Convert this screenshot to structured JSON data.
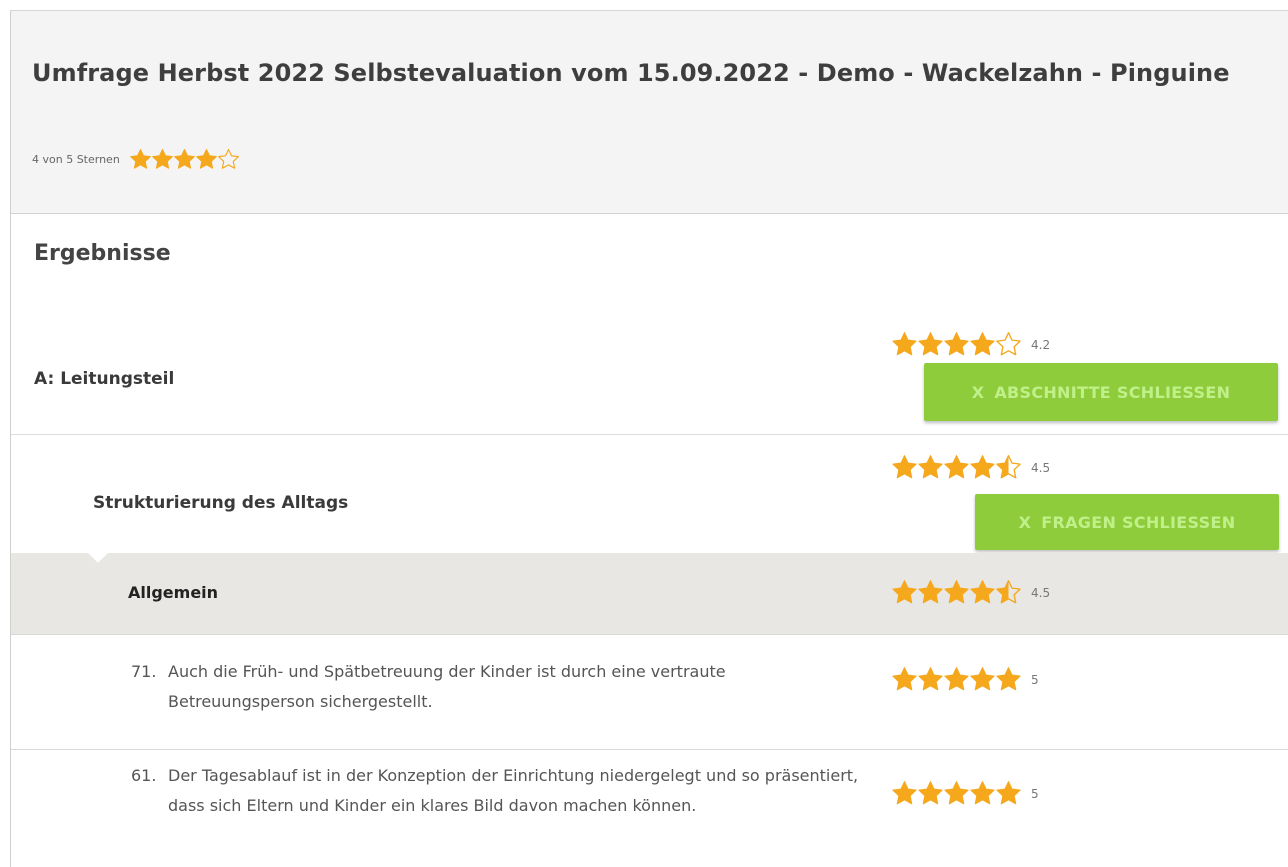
{
  "header": {
    "title": "Umfrage Herbst 2022 Selbstevaluation vom 15.09.2022 - Demo - Wackelzahn - Pinguine",
    "rating_text": "4 von 5 Sternen",
    "rating": 4
  },
  "results": {
    "heading": "Ergebnisse",
    "section": {
      "label": "A: Leitungsteil",
      "score": "4.2",
      "stars": 4,
      "close_label": "ABSCHNITTE SCHLIESSEN",
      "close_icon": "X"
    },
    "subsection": {
      "label": "Strukturierung des Alltags",
      "score": "4.5",
      "stars": 4.5,
      "close_label": "FRAGEN SCHLIESSEN",
      "close_icon": "X"
    },
    "group": {
      "label": "Allgemein",
      "score": "4.5",
      "stars": 4.5
    },
    "questions": [
      {
        "number": "71.",
        "text": "Auch die Früh- und Spätbetreuung der Kinder ist durch eine vertraute Betreuungsperson sichergestellt.",
        "score": "5",
        "stars": 5
      },
      {
        "number": "61.",
        "text": "Der Tagesablauf ist in der Konzeption der Einrichtung niedergelegt und so präsentiert, dass sich Eltern und Kinder ein klares Bild davon machen können.",
        "score": "5",
        "stars": 5
      }
    ]
  },
  "colors": {
    "star": "#f5a81c",
    "button": "#8fcc3b",
    "button_text": "#bff08a",
    "group_bg": "#e8e7e3",
    "header_bg": "#f4f4f4"
  },
  "icons": {
    "star_full": "star-icon",
    "star_half": "star-half-icon",
    "star_empty": "star-outline-icon"
  }
}
